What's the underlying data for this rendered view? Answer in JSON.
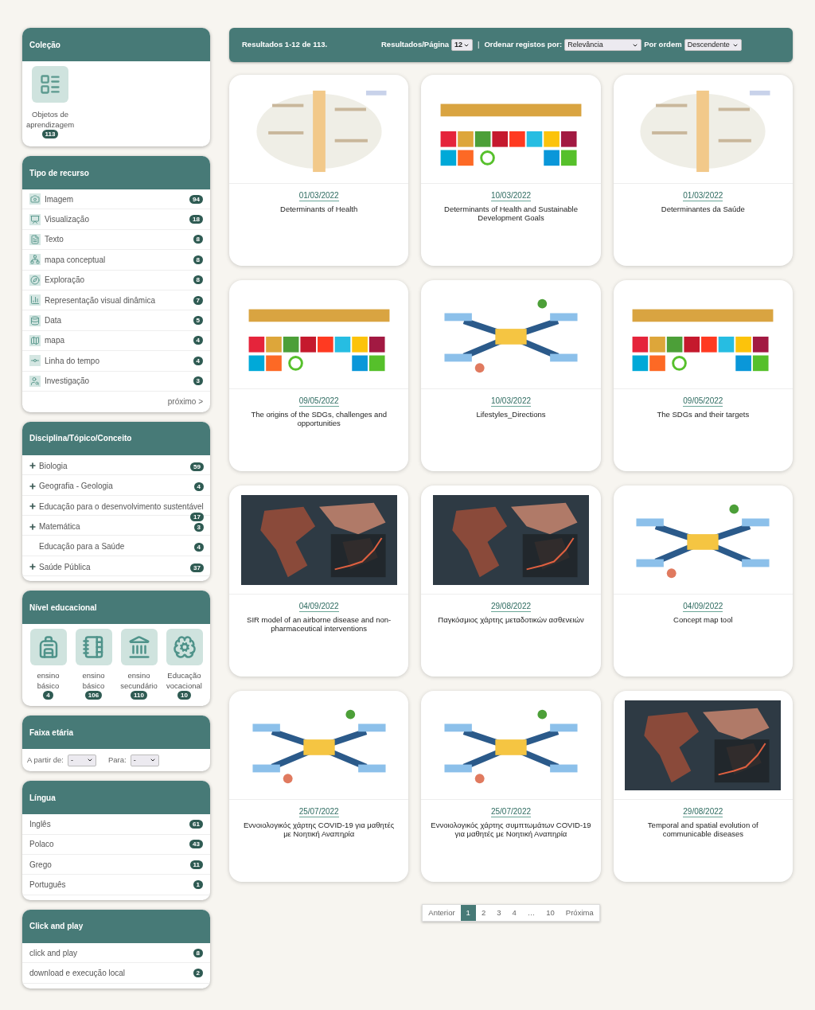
{
  "sidebar": {
    "collection": {
      "title": "Coleção",
      "items": [
        {
          "label": "Objetos de aprendizagem",
          "count": "113"
        }
      ]
    },
    "resource_type": {
      "title": "Tipo de recurso",
      "items": [
        {
          "label": "Imagem",
          "count": "94",
          "kind": "camera"
        },
        {
          "label": "Visualização",
          "count": "18",
          "kind": "presentation"
        },
        {
          "label": "Texto",
          "count": "8",
          "kind": "text"
        },
        {
          "label": "mapa conceptual",
          "count": "8",
          "kind": "network"
        },
        {
          "label": "Exploração",
          "count": "8",
          "kind": "compass"
        },
        {
          "label": "Representação visual dinâmica",
          "count": "7",
          "kind": "chart"
        },
        {
          "label": "Data",
          "count": "5",
          "kind": "data"
        },
        {
          "label": "mapa",
          "count": "4",
          "kind": "map"
        },
        {
          "label": "Linha do tempo",
          "count": "4",
          "kind": "timeline"
        },
        {
          "label": "Investigação",
          "count": "3",
          "kind": "research"
        }
      ],
      "next_link": "próximo >"
    },
    "discipline": {
      "title": "Disciplina/Tópico/Conceito",
      "items": [
        {
          "label": "Biologia",
          "count": "59",
          "expandable": true
        },
        {
          "label": "Geografia - Geologia",
          "count": "4",
          "expandable": true
        },
        {
          "label": "Educação para o desenvolvimento sustentável",
          "count": "17",
          "expandable": true
        },
        {
          "label": "Matemática",
          "count": "3",
          "expandable": true
        },
        {
          "label": "Educação para a Saúde",
          "count": "4",
          "expandable": false
        },
        {
          "label": "Saúde Pública",
          "count": "37",
          "expandable": true
        }
      ]
    },
    "education_level": {
      "title": "Nível educacional",
      "items": [
        {
          "label": "ensino básico",
          "count": "4",
          "kind": "backpack"
        },
        {
          "label": "ensino básico",
          "count": "106",
          "kind": "notebook"
        },
        {
          "label": "ensino secundário",
          "count": "110",
          "kind": "school"
        },
        {
          "label": "Educação vocacional",
          "count": "10",
          "kind": "brain"
        }
      ]
    },
    "age_range": {
      "title": "Faixa etária",
      "from_label": "A partir de:",
      "from_value": "-",
      "to_label": "Para:",
      "to_value": "-"
    },
    "language": {
      "title": "Língua",
      "items": [
        {
          "label": "Inglês",
          "count": "61"
        },
        {
          "label": "Polaco",
          "count": "43"
        },
        {
          "label": "Grego",
          "count": "11"
        },
        {
          "label": "Português",
          "count": "1"
        }
      ]
    },
    "click_and_play": {
      "title": "Click and play",
      "items": [
        {
          "label": "click and play",
          "count": "8"
        },
        {
          "label": "download e execução local",
          "count": "2"
        }
      ]
    }
  },
  "toolbar": {
    "results": "Resultados 1-12 de 113.",
    "per_page_label": "Resultados/Página",
    "per_page": "12",
    "separator": "|",
    "sort_label": "Ordenar registos por:",
    "sort": "Relevância",
    "order_label": "Por ordem",
    "order": "Descendente"
  },
  "cards": [
    {
      "date": "01/03/2022",
      "title": "Determinants of Health"
    },
    {
      "date": "10/03/2022",
      "title": "Determinants of Health and Sustainable Development Goals"
    },
    {
      "date": "01/03/2022",
      "title": "Determinantes da Saúde"
    },
    {
      "date": "09/05/2022",
      "title": "The origins of the SDGs, challenges and opportunities"
    },
    {
      "date": "10/03/2022",
      "title": "Lifestyles_Directions"
    },
    {
      "date": "09/05/2022",
      "title": "The SDGs and their targets"
    },
    {
      "date": "04/09/2022",
      "title": "SIR model of an airborne disease and non-pharmaceutical interventions"
    },
    {
      "date": "29/08/2022",
      "title": "Παγκόσμιος χάρτης μεταδοτικών ασθενειών"
    },
    {
      "date": "04/09/2022",
      "title": "Concept map tool"
    },
    {
      "date": "25/07/2022",
      "title": "Εννοιολογικός χάρτης COVID-19 για μαθητές με Νοητική Αναπηρία"
    },
    {
      "date": "25/07/2022",
      "title": "Εννοιολογικός χάρτης συμπτωμάτων COVID-19 για μαθητές με Νοητική Αναπηρία"
    },
    {
      "date": "29/08/2022",
      "title": "Temporal and spatial evolution of communicable diseases"
    }
  ],
  "pagination": [
    {
      "label": "Anterior",
      "selected": false
    },
    {
      "label": "1",
      "selected": true
    },
    {
      "label": "2",
      "selected": false
    },
    {
      "label": "3",
      "selected": false
    },
    {
      "label": "4",
      "selected": false
    },
    {
      "label": "…",
      "selected": false
    },
    {
      "label": "10",
      "selected": false
    },
    {
      "label": "Próxima",
      "selected": false
    }
  ]
}
